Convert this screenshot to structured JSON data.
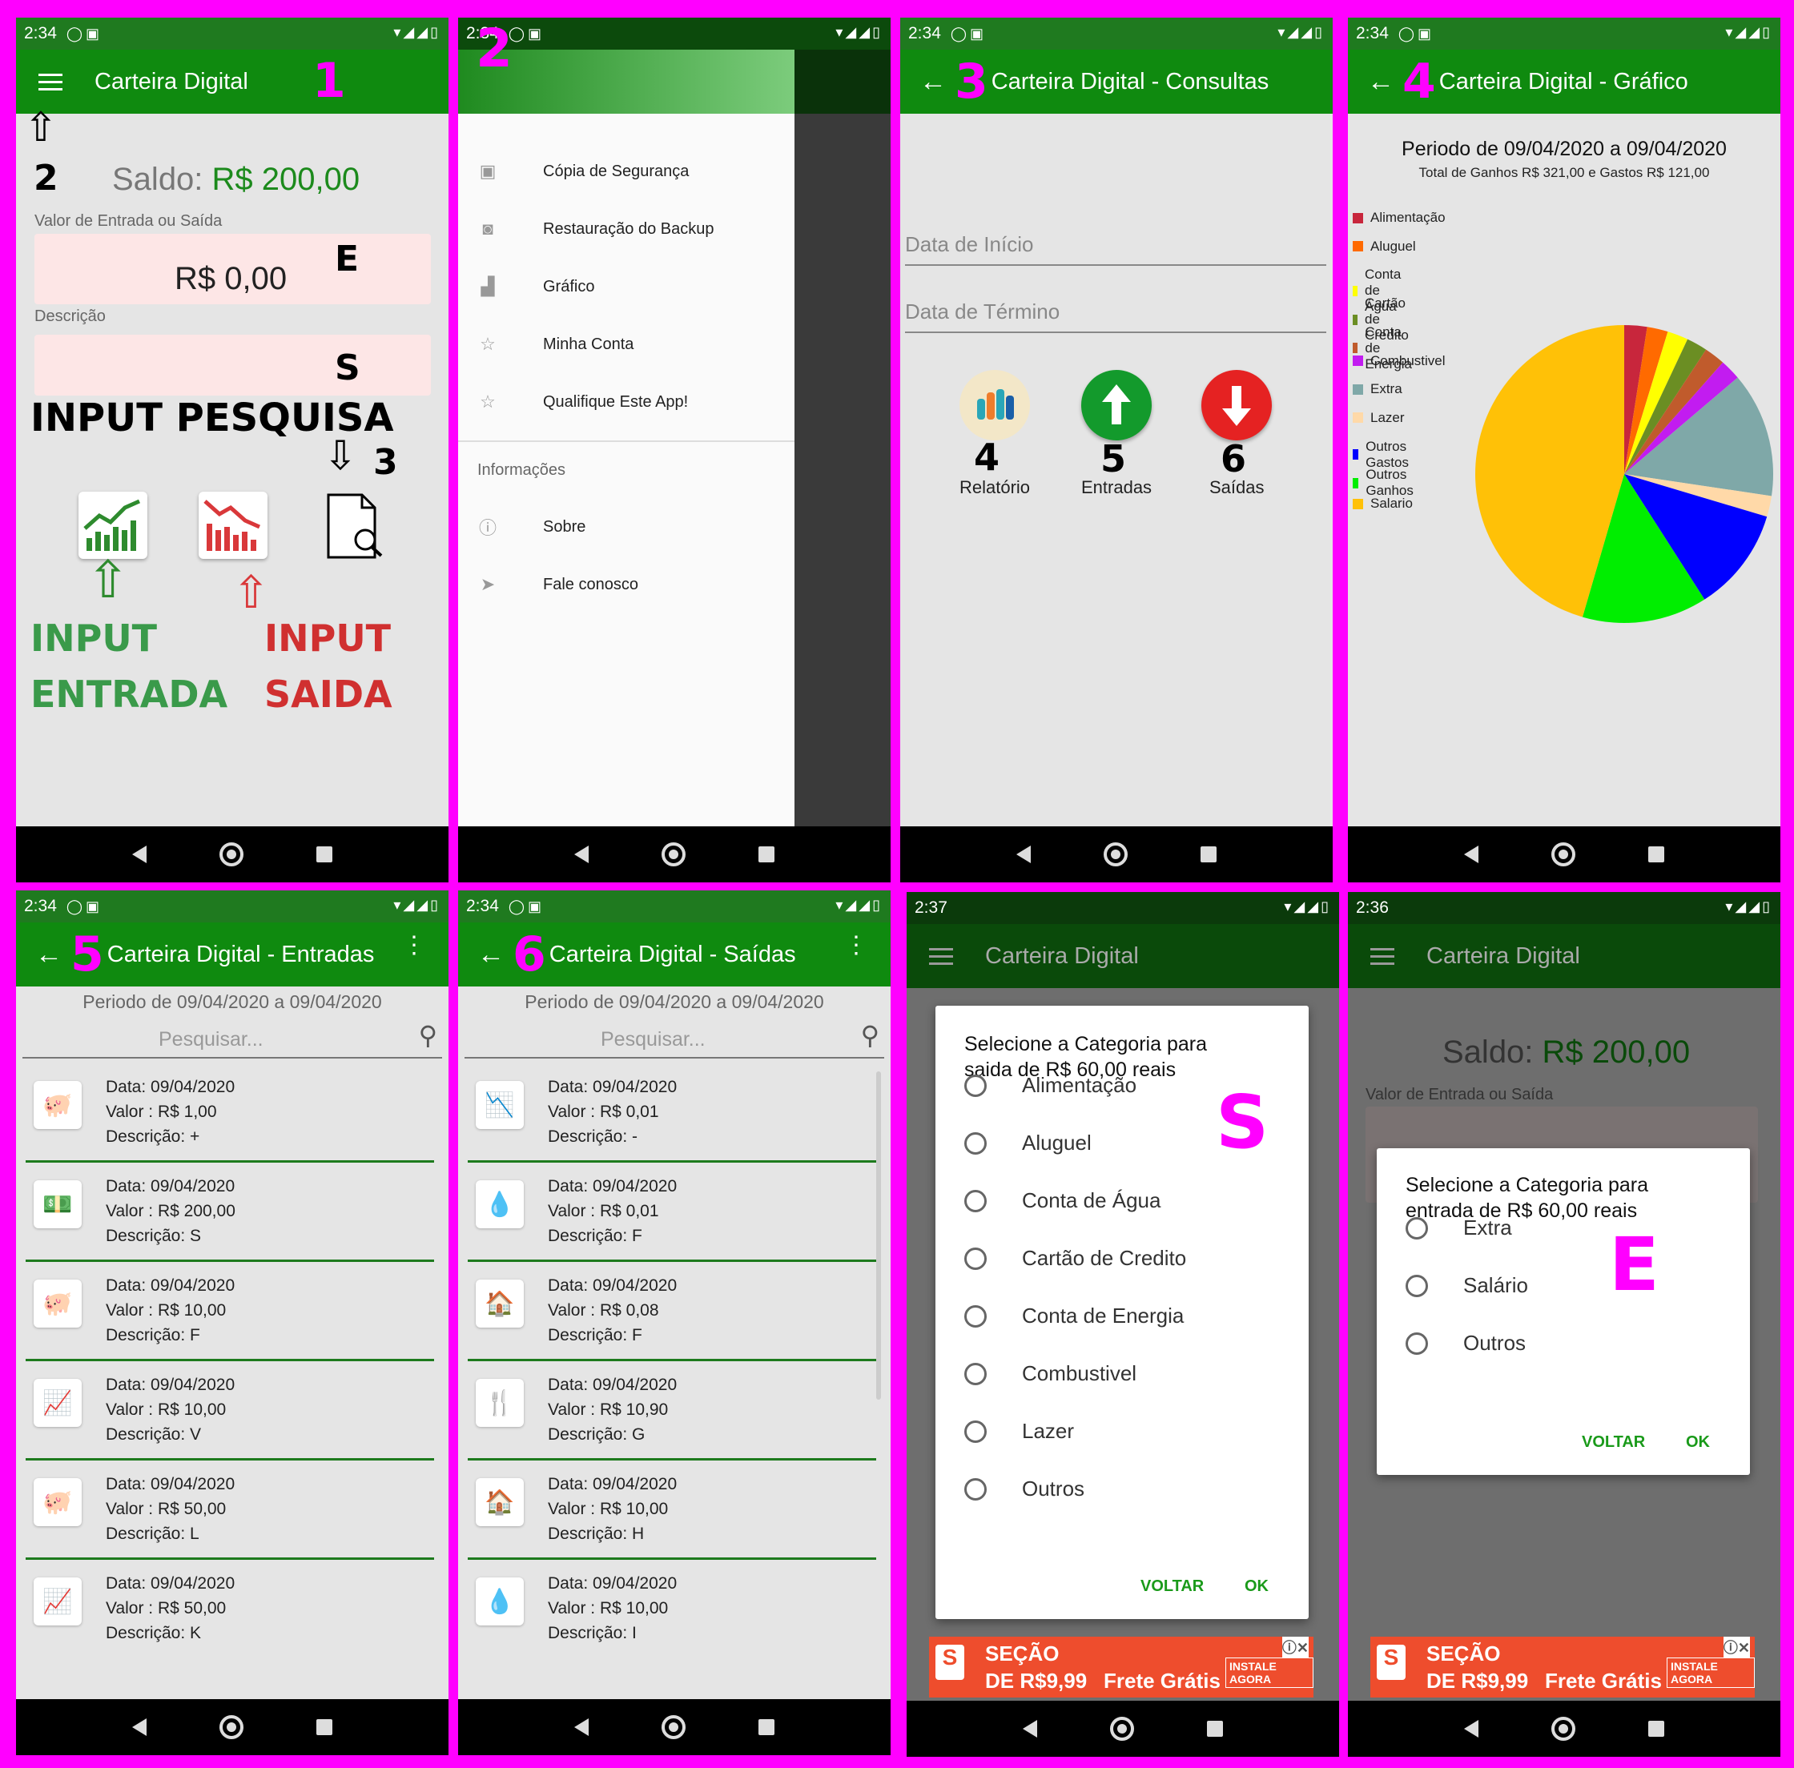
{
  "p1": {
    "time": "2:34",
    "title": "Carteira Digital",
    "tag": "1",
    "saldo_label": "Saldo:",
    "saldo_value": "R$ 200,00",
    "valor_label": "Valor de Entrada ou Saída",
    "valor_value": "R$ 0,00",
    "desc_label": "Descrição",
    "mark_e": "E",
    "mark_s": "S",
    "mark_2": "2",
    "mark_3": "3",
    "input_pesquisa": "INPUT PESQUISA",
    "input_entrada_1": "INPUT",
    "input_entrada_2": "ENTRADA",
    "input_saida_1": "INPUT",
    "input_saida_2": "SAIDA"
  },
  "p2": {
    "time": "2:34",
    "tag": "2",
    "items": [
      "Cópia de Segurança",
      "Restauração do Backup",
      "Gráfico",
      "Minha Conta",
      "Qualifique Este App!"
    ],
    "section": "Informações",
    "info_items": [
      "Sobre",
      "Fale conosco"
    ]
  },
  "p3": {
    "time": "2:34",
    "tag": "3",
    "title": "Carteira Digital - Consultas",
    "inicio_placeholder": "Data de Início",
    "termino_placeholder": "Data de Término",
    "btn4_num": "4",
    "btn4_label": "Relatório",
    "btn5_num": "5",
    "btn5_label": "Entradas",
    "btn6_num": "6",
    "btn6_label": "Saídas"
  },
  "p4": {
    "time": "2:34",
    "tag": "4",
    "title": "Carteira Digital - Gráfico"
  },
  "p5": {
    "time": "2:34",
    "tag": "5",
    "title": "Carteira Digital - Entradas",
    "periodo": "Periodo de 09/04/2020 a 09/04/2020",
    "search_placeholder": "Pesquisar...",
    "rows": [
      {
        "data": "Data: 09/04/2020",
        "valor": "Valor : R$ 1,00",
        "desc": "Descrição: +",
        "icon": "piggy-icon"
      },
      {
        "data": "Data: 09/04/2020",
        "valor": "Valor : R$ 200,00",
        "desc": "Descrição: S",
        "icon": "money-hand-icon"
      },
      {
        "data": "Data: 09/04/2020",
        "valor": "Valor : R$ 10,00",
        "desc": "Descrição: F",
        "icon": "piggy-icon"
      },
      {
        "data": "Data: 09/04/2020",
        "valor": "Valor : R$ 10,00",
        "desc": "Descrição: V",
        "icon": "chart-up-icon"
      },
      {
        "data": "Data: 09/04/2020",
        "valor": "Valor : R$ 50,00",
        "desc": "Descrição: L",
        "icon": "piggy-icon"
      },
      {
        "data": "Data: 09/04/2020",
        "valor": "Valor : R$ 50,00",
        "desc": "Descrição: K",
        "icon": "chart-up-icon"
      }
    ]
  },
  "p6": {
    "time": "2:34",
    "tag": "6",
    "title": "Carteira Digital - Saídas",
    "periodo": "Periodo de 09/04/2020 a 09/04/2020",
    "search_placeholder": "Pesquisar...",
    "rows": [
      {
        "data": "Data: 09/04/2020",
        "valor": "Valor : R$ 0,01",
        "desc": "Descrição: -",
        "icon": "chart-down-icon"
      },
      {
        "data": "Data: 09/04/2020",
        "valor": "Valor : R$ 0,01",
        "desc": "Descrição: F",
        "icon": "water-drop-icon"
      },
      {
        "data": "Data: 09/04/2020",
        "valor": "Valor : R$ 0,08",
        "desc": "Descrição: F",
        "icon": "house-money-icon"
      },
      {
        "data": "Data: 09/04/2020",
        "valor": "Valor : R$ 10,90",
        "desc": "Descrição: G",
        "icon": "fork-knife-icon"
      },
      {
        "data": "Data: 09/04/2020",
        "valor": "Valor : R$ 10,00",
        "desc": "Descrição: H",
        "icon": "house-money-icon"
      },
      {
        "data": "Data: 09/04/2020",
        "valor": "Valor : R$ 10,00",
        "desc": "Descrição: I",
        "icon": "water-drop-icon"
      }
    ]
  },
  "p7": {
    "time": "2:37",
    "title": "Carteira Digital",
    "dialog_title": "Selecione a Categoria para saida de R$ 60,00 reais",
    "mark": "S",
    "options": [
      "Alimentação",
      "Aluguel",
      "Conta de Água",
      "Cartão de Credito",
      "Conta de Energia",
      "Combustivel",
      "Lazer",
      "Outros"
    ],
    "voltar": "VOLTAR",
    "ok": "OK",
    "ad1": "SEÇÃO",
    "ad2": "DE R$9,99",
    "ad3": "Frete Grátis",
    "ad4": "INSTALE AGORA"
  },
  "p8": {
    "time": "2:36",
    "title": "Carteira Digital",
    "saldo_label": "Saldo:",
    "saldo_value": "R$ 200,00",
    "valor_label": "Valor de Entrada ou Saída",
    "dialog_title": "Selecione a Categoria para entrada de R$ 60,00 reais",
    "mark": "E",
    "options": [
      "Extra",
      "Salário",
      "Outros"
    ],
    "voltar": "VOLTAR",
    "ok": "OK",
    "ad1": "SEÇÃO",
    "ad2": "DE R$9,99",
    "ad3": "Frete Grátis",
    "ad4": "INSTALE AGORA"
  },
  "chart_data": {
    "type": "pie",
    "title": "Periodo de 09/04/2020 a 09/04/2020",
    "subtitle": "Total de Ganhos R$ 321,00 e Gastos R$ 121,00",
    "legend_position": "left",
    "categories": [
      "Alimentação",
      "Aluguel",
      "Conta de Água",
      "Cartão de Credito",
      "Conta de Energia",
      "Combustivel",
      "Extra",
      "Lazer",
      "Outros Gastos",
      "Outros Ganhos",
      "Salario"
    ],
    "values": [
      10.9,
      10,
      10,
      10,
      10,
      10,
      60,
      10,
      50,
      60,
      201
    ],
    "colors": [
      "#c8263c",
      "#ff6a00",
      "#ffff00",
      "#6b8e23",
      "#c05b2c",
      "#c21cf0",
      "#7fa8a8",
      "#ffd9a8",
      "#0000ff",
      "#00ee00",
      "#ffc107"
    ]
  }
}
